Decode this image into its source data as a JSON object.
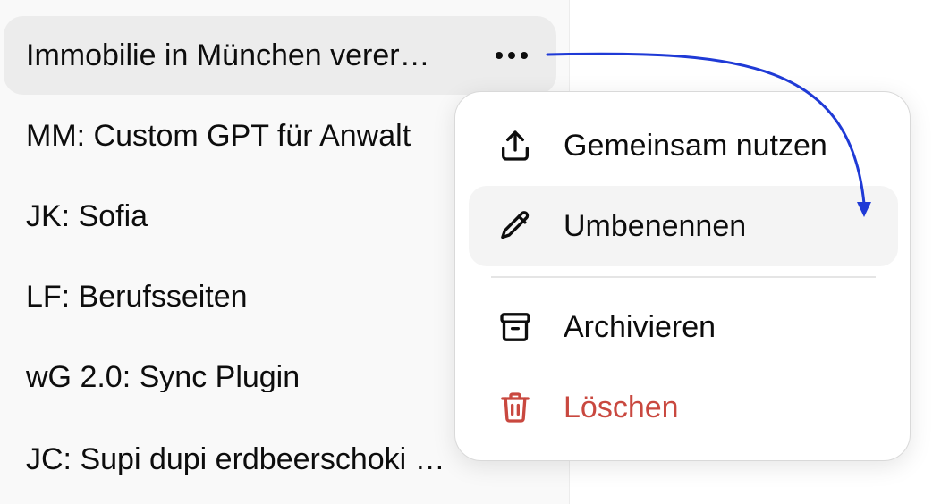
{
  "sidebar": {
    "items": [
      {
        "label": "Immobilie in München verer…",
        "active": true
      },
      {
        "label": "MM: Custom GPT für Anwalt"
      },
      {
        "label": "JK: Sofia"
      },
      {
        "label": "LF: Berufsseiten"
      },
      {
        "label": "wG 2.0: Sync Plugin"
      },
      {
        "label": "JC: Supi dupi erdbeerschoki …"
      }
    ]
  },
  "context_menu": {
    "items": [
      {
        "label": "Gemeinsam nutzen",
        "icon": "share-icon"
      },
      {
        "label": "Umbenennen",
        "icon": "pencil-icon",
        "highlighted": true
      },
      {
        "label": "Archivieren",
        "icon": "archive-icon"
      },
      {
        "label": "Löschen",
        "icon": "trash-icon",
        "danger": true
      }
    ]
  },
  "colors": {
    "danger": "#c9483f",
    "annotation_arrow": "#1f3ad6",
    "sidebar_bg": "#f9f9f9",
    "active_item_bg": "#ececec"
  }
}
